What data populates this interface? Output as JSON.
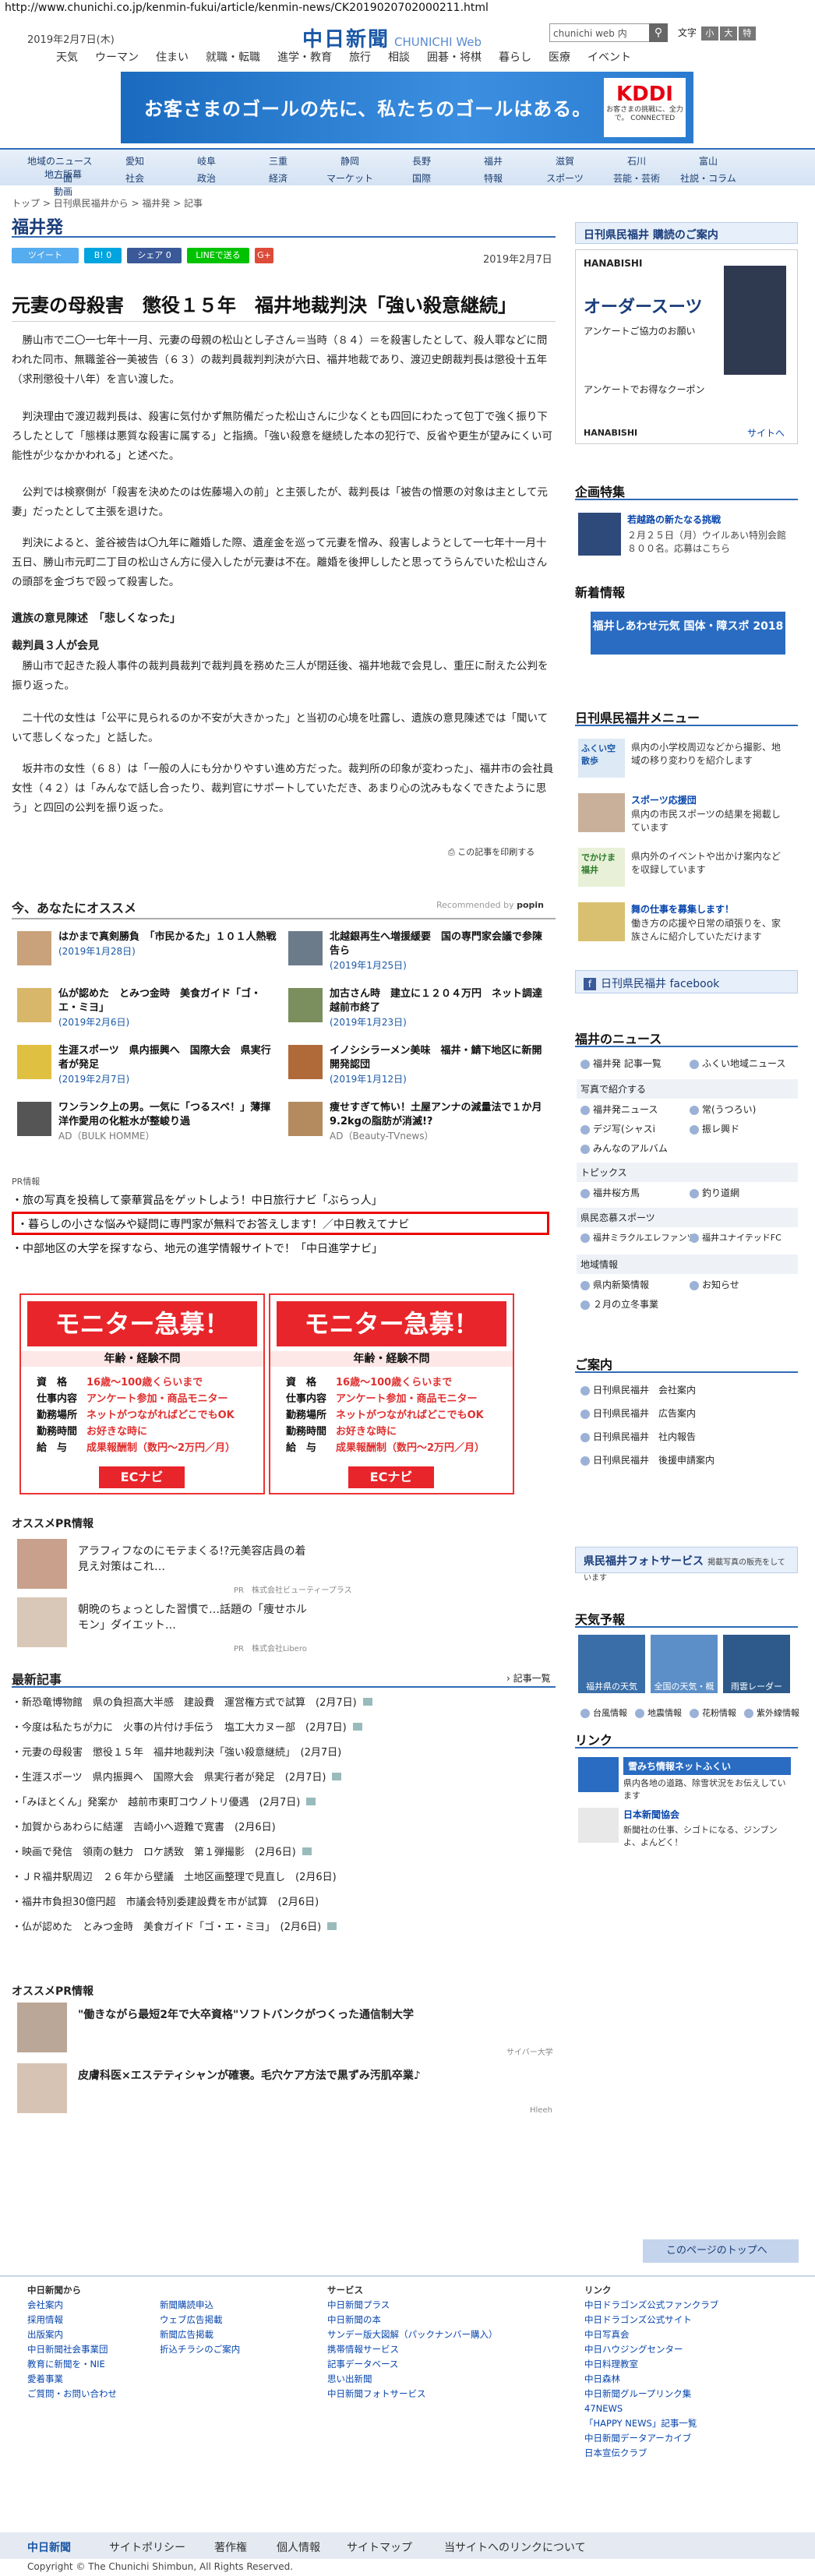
{
  "browser": {
    "url": "http://www.chunichi.co.jp/kenmin-fukui/article/kenmin-news/CK2019020702000211.html"
  },
  "header": {
    "date": "2019年2月7日(木)",
    "logo": "中日新聞",
    "logo_sub": "CHUNICHI Web",
    "search_placeholder": "chunichi web 内",
    "font_label": "文字",
    "font_small": "小",
    "font_big": "大",
    "font_larger": "特"
  },
  "topnav": [
    "天気",
    "ウーマン",
    "住まい",
    "就職・転職",
    "進学・教育",
    "旅行",
    "相談",
    "囲碁・将棋",
    "暮らし",
    "医療",
    "イベント"
  ],
  "ad": {
    "text": "お客さまのゴールの先に、私たちのゴールはある。",
    "brand": "KDDI",
    "brand_sub": "お客さまの挑戦に、全力で。 CONNECTED"
  },
  "regions": {
    "row1": [
      "地域のニュース",
      "愛知",
      "岐阜",
      "三重",
      "静岡",
      "長野",
      "福井",
      "滋賀",
      "石川",
      "富山",
      "地方版幕"
    ],
    "row2": [
      "一面",
      "社会",
      "政治",
      "経済",
      "マーケット",
      "国際",
      "特報",
      "スポーツ",
      "芸能・芸術",
      "社説・コラム",
      "動画"
    ]
  },
  "breadcrumb": "トップ > 日刊県民福井から > 福井発 > 記事",
  "section": "福井発",
  "share": {
    "tweet": "ツイート",
    "b": "B!",
    "share": "シェア",
    "share_count": "0",
    "line": "LINEで送る",
    "g": "G+"
  },
  "article": {
    "date": "2019年2月7日",
    "title": "元妻の母殺害　懲役１５年　福井地裁判決「強い殺意継続」",
    "p1": "　勝山市で二〇一七年十一月、元妻の母親の松山とし子さん＝当時（８４）＝を殺害したとして、殺人罪などに問われた同市、無職釜谷一美被告（６３）の裁判員裁判判決が六日、福井地裁であり、渡辺史朗裁判長は懲役十五年（求刑懲役十八年）を言い渡した。",
    "p2": "　判決理由で渡辺裁判長は、殺害に気付かず無防備だった松山さんに少なくとも四回にわたって包丁で強く振り下ろしたとして「態様は悪質な殺害に属する」と指摘。「強い殺意を継続した本の犯行で、反省や更生が望みにくい可能性が少なかかわれる」と述べた。",
    "p3": "　公判では検察側が「殺害を決めたのは佐藤場入の前」と主張したが、裁判長は「被告の憎悪の対象は主として元妻」だったとして主張を退けた。",
    "p4": "　判決によると、釜谷被告は〇九年に離婚した際、遺産金を巡って元妻を憎み、殺害しようとして一七年十一月十五日、勝山市元町二丁目の松山さん方に侵入したが元妻は不在。離婚を後押ししたと思ってうらんでいた松山さんの頭部を金づちで殴って殺害した。",
    "sub1": "遺族の意見陳述　「悲しくなった」",
    "sub2": "裁判員３人が会見",
    "p5": "　勝山市で起きた殺人事件の裁判員裁判で裁判員を務めた三人が閉廷後、福井地裁で会見し、重圧に耐えた公判を振り返った。",
    "p6": "　二十代の女性は「公平に見られるのか不安が大きかった」と当初の心境を吐露し、遺族の意見陳述では「聞いていて悲しくなった」と話した。",
    "p7": "　坂井市の女性（６８）は「一般の人にも分かりやすい進め方だった。裁判所の印象が変わった」、福井市の会社員女性（４２）は「みんなで話し合ったり、裁判官にサポートしていただき、あまり心の沈みもなくできたように思う」と四回の公判を振り返った。",
    "print": "この記事を印刷する"
  },
  "recommend": {
    "title": "今、あなたにオススメ",
    "by": "Recommended by",
    "items": [
      {
        "title": "はかまで真剣勝負　「市民かるた」１０１人熱戦",
        "date": "(2019年1月28日)"
      },
      {
        "title": "北越銀再生へ増援緩要　国の専門家会議で参陳告ら",
        "date": "(2019年1月25日)"
      },
      {
        "title": "仏が認めた　とみつ金時　美食ガイド「ゴ・エ・ミヨ」",
        "date": "(2019年2月6日)"
      },
      {
        "title": "加古さん時　建立に１２０４万円　ネット調達　越前市終了",
        "date": "(2019年1月23日)"
      },
      {
        "title": "生涯スポーツ　県内振興へ　国際大会　県実行者が発足",
        "date": "(2019年2月7日)"
      },
      {
        "title": "イノシシラーメン美味　福井・鯖下地区に新開開発認団",
        "date": "(2019年1月12日)"
      },
      {
        "title": "ワンランク上の男。一気に「つるスベ！」薄揮洋作愛用の化粧水が整峻り過",
        "date": "AD（BULK HOMME）"
      },
      {
        "title": "痩せすぎて怖い！土屋アンナの減量法で１か月9.2kgの脂肪が消滅!?",
        "date": "AD（Beauty-TVnews）"
      }
    ]
  },
  "pr": {
    "label": "PR情報",
    "lines": [
      "旅の写真を投稿して豪華賞品をゲットしよう！中日旅行ナビ「ぶらっ人」",
      "暮らしの小さな悩みや疑問に専門家が無料でお答えします！／中日教えてナビ",
      "中部地区の大学を探すなら、地元の進学情報サイトで！「中日進学ナビ」"
    ]
  },
  "banner": {
    "head": "モニター急募！",
    "sub": "年齢・経験不問",
    "rows": [
      [
        "資　格",
        "16歳～100歳くらいまで"
      ],
      [
        "仕事内容",
        "アンケート参加・商品モニター"
      ],
      [
        "勤務場所",
        "ネットがつながればどこでもOK"
      ],
      [
        "勤務時間",
        "お好きな時に"
      ],
      [
        "給　与",
        "成果報酬制（数円～2万円／月）"
      ]
    ],
    "logo": "ECナビ"
  },
  "osusume_pr": {
    "title": "オススメPR情報",
    "items": [
      {
        "title": "アラフィフなのにモテまくる!?元美容店員の着見え対策はこれ…",
        "src": "PR　株式会社ビューティープラス"
      },
      {
        "title": "朝晩のちょっとした習慣で…話題の「痩せホルモン」ダイエット…",
        "src": "PR　株式会社Libero"
      }
    ]
  },
  "latest": {
    "title": "最新記事",
    "more": "記事一覧",
    "items": [
      "新恐竜博物館　県の負担高大半感　建設費　運営権方式で試算　(2月7日)",
      "今度は私たちが力に　火事の片付け手伝う　塩工大カヌー部　(2月7日)",
      "元妻の母殺害　懲役１５年　福井地裁判決「強い殺意継続」　(2月7日)",
      "生涯スポーツ　県内振興へ　国際大会　県実行者が発足　(2月7日)",
      "「みほとくん」発案か　越前市東町コウノトリ優遇　(2月7日)",
      "加賀からあわらに結運　吉崎小へ遊難で寛書　(2月6日)",
      "映画で発信　領南の魅力　ロケ誘致　第１弾撮影　(2月6日)",
      "ＪＲ福井駅周辺　２６年から壁議　土地区画整理で見直し　(2月6日)",
      "福井市負担30億円超　市議会特別委建設費を市が試算　(2月6日)",
      "仏が認めた　とみつ金時　美食ガイド「ゴ・エ・ミヨ」　(2月6日)"
    ]
  },
  "osusume_pr2": {
    "title": "オススメPR情報",
    "items": [
      {
        "title": "\"働きながら最短2年で大卒資格\"ソフトバンクがつくった通信制大学",
        "src": "サイバー大学"
      },
      {
        "title": "皮膚科医×エステティシャンが確褒。毛穴ケア方法で黒ずみ汚肌卒業♪",
        "src": "Hleeh"
      }
    ]
  },
  "sidebar": {
    "subscribe": "日刊県民福井 購読のご案内",
    "ad_brand": "HANABISHI",
    "ad_title": "オーダースーツ",
    "ad_sub": "アンケートご協力のお願い",
    "ad_coupon": "アンケートでお得なクーポン",
    "ad_link": "サイトへ",
    "planning": "企画特集",
    "planning_title": "若越路の新たなる挑戦",
    "planning_text": "２月２５日（月）ウイルあい特別会館８００名。応募はこちら",
    "new_info": "新着情報",
    "shiawase": "福井しあわせ元気 国体・障スポ 2018",
    "menu_title": "日刊県民福井メニュー",
    "menu": [
      {
        "label": "ふくい空散歩",
        "text": "県内の小学校周辺などから撮影、地域の移り変わりを紹介します"
      },
      {
        "label": "スポーツ応援団",
        "text": "県内の市民スポーツの結果を掲載しています"
      },
      {
        "label": "でかけま福井",
        "text": "県内外のイベントや出かけ案内などを収録しています"
      },
      {
        "label": "舞の仕事を募集します！",
        "text": "働き方の応援や日常の頑張りを、家族さんに紹介していただけます"
      }
    ],
    "facebook": "日刊県民福井 facebook",
    "fukui_news": "福井のニュース",
    "news_links": [
      [
        "福井発 記事一覧",
        "ふくい地域ニュース"
      ],
      [
        "写真で紹介する",
        ""
      ],
      [
        "福井発ニュース",
        "常(うつろい)"
      ],
      [
        "デジ写(シャスi",
        "振レ興ド"
      ],
      [
        "みんなのアルバム",
        ""
      ]
    ],
    "topics": "トピックス",
    "topic_links": [
      "福井桜方馬",
      "釣り道網"
    ],
    "sports": "県民恋慕スポーツ",
    "sports_links": [
      "福井ミラクルエレファンツ",
      "福井ユナイテッドFC"
    ],
    "local": "地域情報",
    "local_links": [
      "県内新築情報",
      "お知らせ",
      "２月の立冬事業"
    ],
    "guide": "ご案内",
    "guide_links": [
      "日刊県民福井　会社案内",
      "日刊県民福井　広告案内",
      "日刊県民福井　社内報告",
      "日刊県民福井　後援申請案内"
    ],
    "photo_service": "県民福井フォトサービス",
    "photo_sub": "掲載写真の販売をしています",
    "weather": "天気予報",
    "weather_items": [
      "福井県の天気",
      "全国の天気・概況",
      "雨雲レーダー"
    ],
    "weather_links": [
      "台風情報",
      "地震情報",
      "花粉情報",
      "紫外線情報"
    ],
    "links": "リンク",
    "snow": "雪みち情報ネットふくい",
    "snow_text": "県内各地の道路、除雪状況をお伝えしています",
    "nihon": "日本新聞協会",
    "nihon_text": "新聞社の仕事、シゴトになる、ジンブンよ、よんどく！"
  },
  "totop": "このページのトップへ",
  "footer": {
    "col1": [
      "中日新聞から",
      "会社案内",
      "採用情報",
      "出版案内",
      "中日新聞社会事業団",
      "教育に新聞を・NIE",
      "愛着事業",
      "ご質問・お問い合わせ"
    ],
    "col2": [
      "新聞購読申込",
      "ウェブ広告掲載",
      "新聞広告掲載",
      "折込チラシのご案内"
    ],
    "col3": [
      "サービス",
      "中日新聞プラス",
      "中日新聞の本",
      "サンデー版大図解（パックナンバー購入）",
      "携帯情報サービス",
      "記事データベース",
      "思い出新聞",
      "中日新聞フォトサービス"
    ],
    "col4": [
      "リンク",
      "中日ドラゴンズ公式ファンクラブ",
      "中日ドラゴンズ公式サイト",
      "中日写真会",
      "中日ハウジングセンター",
      "中日料理教室",
      "中日森林",
      "中日新聞グループリンク集",
      "47NEWS",
      "「HAPPY NEWS」記事一覧",
      "中日新聞データアーカイブ",
      "日本宣伝クラブ"
    ]
  },
  "footbar": {
    "logo": "中日新聞",
    "links": [
      "サイトポリシー",
      "著作権",
      "個人情報",
      "サイトマップ",
      "当サイトへのリンクについて"
    ]
  },
  "copyright": "Copyright © The Chunichi Shimbun, All Rights Reserved."
}
